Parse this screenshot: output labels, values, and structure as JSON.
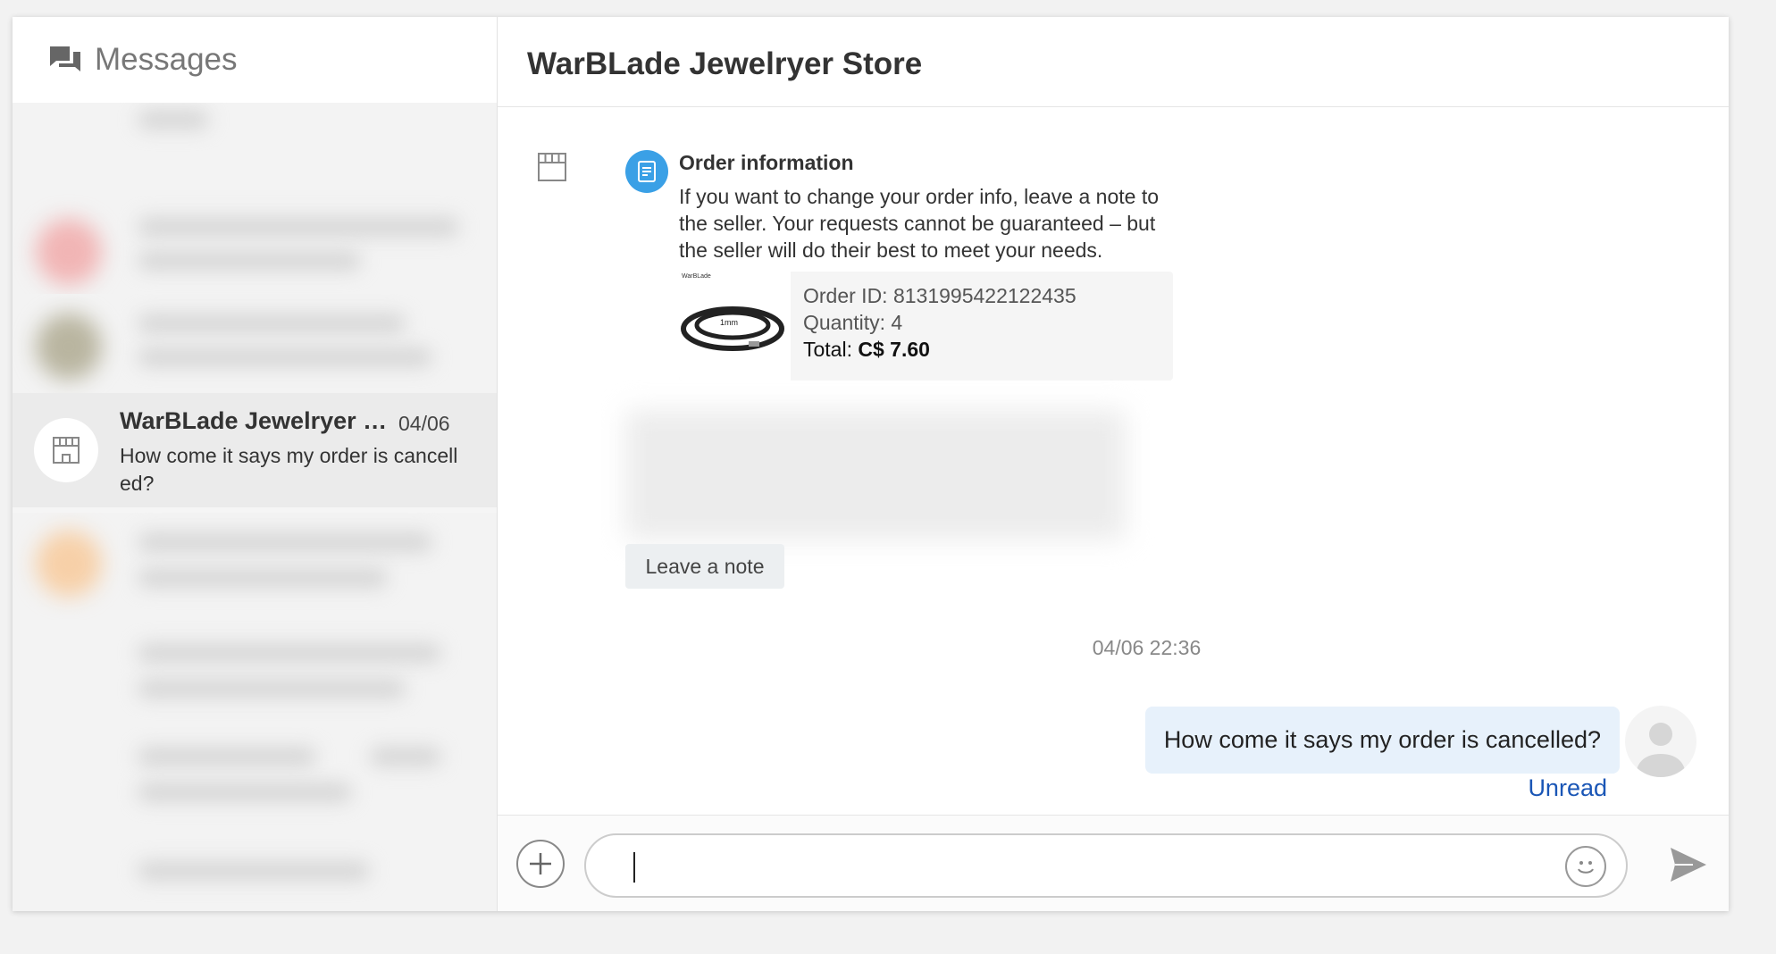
{
  "sidebar": {
    "title": "Messages",
    "title_icon": "chat-bubbles-icon",
    "active_conversation": {
      "name": "WarBLade Jewelryer Store",
      "date": "04/06",
      "preview": "How come it says my order is cancelled?",
      "avatar_icon": "store-icon"
    }
  },
  "chat": {
    "title": "WarBLade Jewelryer Store",
    "order_info": {
      "icon": "document-icon",
      "title": "Order information",
      "description": "If you want to change your order info, leave a note to the seller. Your requests cannot be guaranteed – but the seller will do their best to meet your needs.",
      "thumb_brand": "WarBLade",
      "thumb_caption": "1mm",
      "order_id_label": "Order ID: 8131995422122435",
      "quantity_label": "Quantity: 4",
      "total_label": "Total:",
      "total_value": "C$ 7.60"
    },
    "leave_note_label": "Leave a note",
    "timestamp": "04/06 22:36",
    "messages": [
      {
        "text": "How come it says my order is cancelled?",
        "status": "Unread"
      }
    ]
  },
  "input": {
    "value": "",
    "plus_icon": "plus-icon",
    "emoji_icon": "emoji-icon",
    "send_icon": "send-icon"
  },
  "colors": {
    "accent": "#3aa0e6",
    "bubble": "#e7f1fb",
    "unread_link": "#1a56b6",
    "active_item": "#ebebeb"
  }
}
